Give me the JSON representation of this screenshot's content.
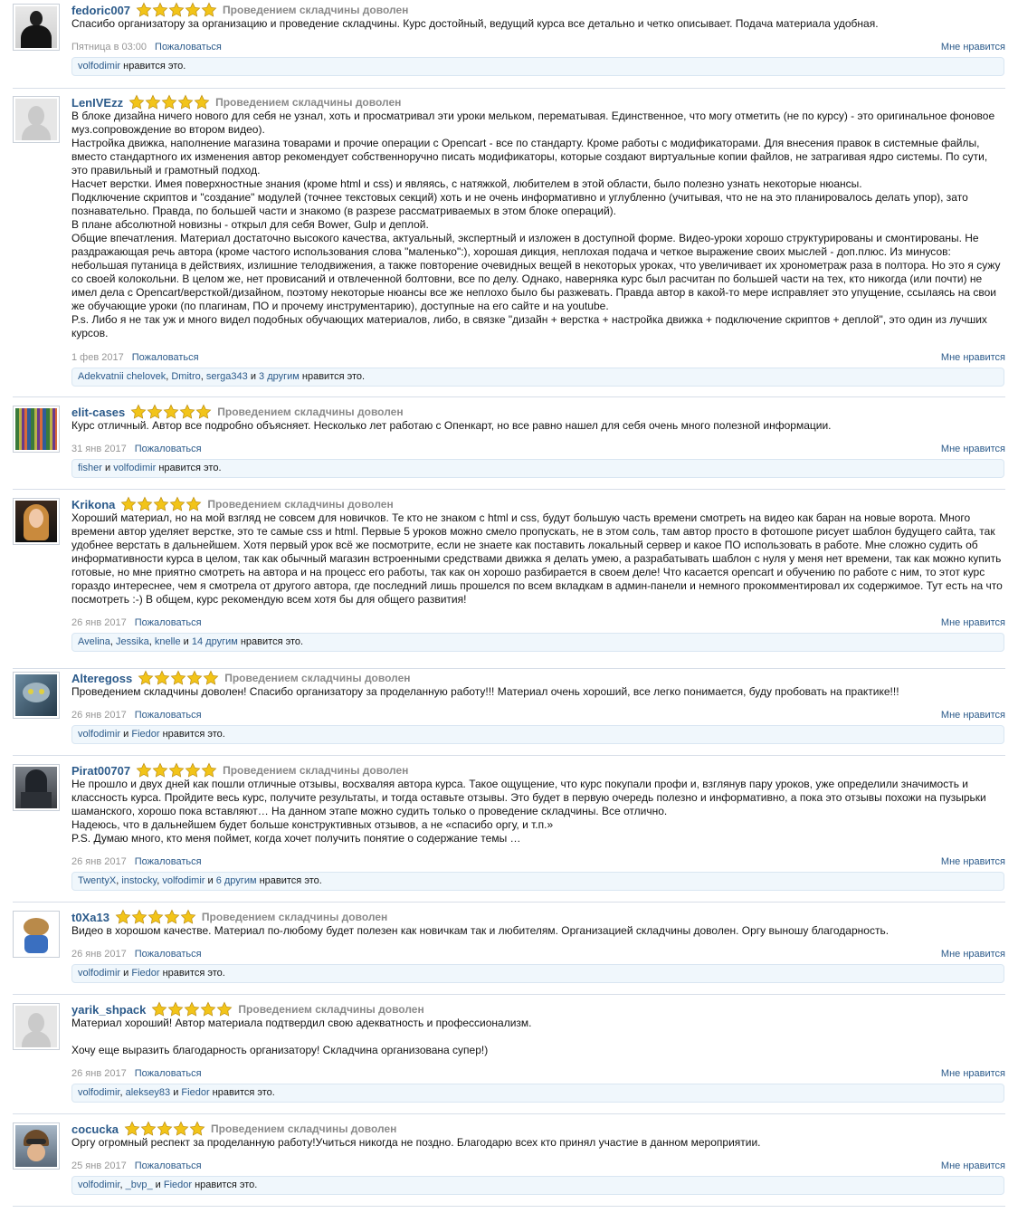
{
  "reviews": [
    {
      "author": "fedoric007",
      "avatar_icon": "user-avatar-suit",
      "rating": 5,
      "verdict": "Проведением складчины доволен",
      "text": "Спасибо организатору за организацию и проведение складчины. Курс достойный, ведущий курса все детально и четко описывает. Подача материала удобная.",
      "date": "Пятница в 03:00",
      "report_label": "Пожаловаться",
      "like_label": "Мне нравится",
      "likes": {
        "users": [
          "volfodimir"
        ],
        "others": "",
        "suffix": "нравится это."
      }
    },
    {
      "author": "LenIVEzz",
      "avatar_icon": "default-avatar-icon",
      "rating": 5,
      "verdict": "Проведением складчины доволен",
      "text": "В блоке дизайна ничего нового для себя не узнал, хоть и просматривал эти уроки мельком, перематывая. Единственное, что могу отметить (не по курсу) - это оригинальное фоновое муз.сопровождение во втором видео).\nНастройка движка, наполнение магазина товарами и прочие операции с Opencart - все по стандарту. Кроме работы с модификаторами. Для внесения правок в системные файлы, вместо стандартного их изменения автор рекомендует собственноручно писать модификаторы, которые создают виртуальные копии файлов, не затрагивая ядро системы. По сути, это правильный и грамотный подход.\nНасчет верстки. Имея поверхностные знания (кроме html и css) и являясь, с натяжкой, любителем в этой области, было полезно узнать некоторые нюансы.\nПодключение скриптов и \"создание\" модулей (точнее текстовых секций) хоть и не очень информативно и углубленно (учитывая, что не на это планировалось делать упор), зато познавательно. Правда, по большей части и знакомо (в разрезе рассматриваемых в этом блоке операций).\nВ плане абсолютной новизны - открыл для себя Bower, Gulp и деплой.\nОбщие впечатления. Материал достаточно высокого качества, актуальный, экспертный и изложен в доступной форме. Видео-уроки хорошо структурированы и смонтированы. Не раздражающая речь автора (кроме частого использования слова \"маленько\":), хорошая дикция, неплохая подача и четкое выражение своих мыслей - доп.плюс. Из минусов: небольшая путаница в действиях, излишние телодвижения, а также повторение очевидных вещей в некоторых уроках, что увеличивает их хронометраж раза в полтора. Но это я сужу со своей колокольни. В целом же, нет провисаний и отвлеченной болтовни, все по делу. Однако, наверняка курс был расчитан по большей части на тех, кто никогда (или почти) не имел дела с Opencart/версткой/дизайном, поэтому некоторые нюансы все же неплохо было бы разжевать. Правда автор в какой-то мере исправляет это упущение, ссылаясь на свои же обучающие уроки (по плагинам, ПО и прочему инструментарию), доступные на его сайте и на youtube.\nP.s. Либо я не так уж и много видел подобных обучающих материалов, либо, в связке \"дизайн + верстка + настройка движка + подключение скриптов + деплой\", это один из лучших курсов.",
      "date": "1 фев 2017",
      "report_label": "Пожаловаться",
      "like_label": "Мне нравится",
      "likes": {
        "users": [
          "Adekvatnii chelovek",
          "Dmitro",
          "serga343"
        ],
        "others": "3 другим",
        "suffix": "нравится это."
      }
    },
    {
      "author": "elit-cases",
      "avatar_icon": "books-avatar",
      "rating": 5,
      "verdict": "Проведением складчины доволен",
      "text": "Курс отличный. Автор все подробно объясняет. Несколько лет работаю с Опенкарт, но все равно нашел для себя очень много полезной информации.",
      "date": "31 янв 2017",
      "report_label": "Пожаловаться",
      "like_label": "Мне нравится",
      "likes": {
        "users": [
          "fisher",
          "volfodimir"
        ],
        "others": "",
        "suffix": "нравится это."
      }
    },
    {
      "author": "Krikona",
      "avatar_icon": "user-avatar-girl",
      "rating": 5,
      "verdict": "Проведением складчины доволен",
      "text": "Хороший материал, но на мой взгляд не совсем для новичков. Те кто не знаком с html и css, будут большую часть времени смотреть на видео как баран на новые ворота. Много времени автор уделяет верстке, это те самые css и html. Первые 5 уроков можно смело пропускать, не в этом соль, там автор просто в фотошопе рисует шаблон будущего сайта, так удобнее верстать в дальнейшем. Хотя первый урок всё же посмотрите, если не знаете как поставить локальный сервер и какое ПО использовать в работе. Мне сложно судить об информативности курса в целом, так как обычный магазин встроенными средствами движка я делать умею, а разрабатывать шаблон с нуля у меня нет времени, так как можно купить готовые, но мне приятно смотреть на автора и на процесс его работы, так как он хорошо разбирается в своем деле! Что касается opencart и обучению по работе с ним, то этот курс гораздо интереснее, чем я смотрела от другого автора, где последний лишь прошелся по всем вкладкам в админ-панели и немного прокомментировал их содержимое. Тут есть на что посмотреть :-) В общем, курс рекомендую всем хотя бы для общего развития!",
      "date": "26 янв 2017",
      "report_label": "Пожаловаться",
      "like_label": "Мне нравится",
      "likes": {
        "users": [
          "Avelina",
          "Jessika",
          "knelle"
        ],
        "others": "14 другим",
        "suffix": "нравится это."
      }
    },
    {
      "author": "Alteregoss",
      "avatar_icon": "cat-avatar",
      "rating": 5,
      "verdict": "Проведением складчины доволен",
      "text": "Проведением складчины доволен! Спасибо организатору за проделанную работу!!! Материал очень хороший, все легко понимается, буду пробовать на практике!!!",
      "date": "26 янв 2017",
      "report_label": "Пожаловаться",
      "like_label": "Мне нравится",
      "likes": {
        "users": [
          "volfodimir",
          "Fiedor"
        ],
        "others": "",
        "suffix": "нравится это."
      }
    },
    {
      "author": "Pirat00707",
      "avatar_icon": "assassin-avatar",
      "rating": 5,
      "verdict": "Проведением складчины доволен",
      "text": "Не прошло и двух дней как пошли отличные отзывы, восхваляя автора курса. Такое ощущение, что курс покупали профи и, взглянув пару уроков, уже определили значимость и классность курса. Пройдите весь курс, получите результаты, и тогда оставьте отзывы. Это будет в первую очередь полезно и информативно, а пока это отзывы похожи на пузырьки шаманского, хорошо пока вставляют… На данном этапе можно судить только о проведение складчины. Все отлично.\nНадеюсь, что в дальнейшем будет больше конструктивных отзывов, а не «спасибо оргу, и т.п.»\nP.S. Думаю много, кто меня поймет, когда хочет получить понятие о содержание темы …",
      "date": "26 янв 2017",
      "report_label": "Пожаловаться",
      "like_label": "Мне нравится",
      "likes": {
        "users": [
          "TwentyX",
          "instocky",
          "volfodimir"
        ],
        "others": "6 другим",
        "suffix": "нравится это."
      }
    },
    {
      "author": "t0Xa13",
      "avatar_icon": "mascot-avatar",
      "rating": 5,
      "verdict": "Проведением складчины доволен",
      "text": "Видео в хорошом качестве. Материал по-любому будет полезен как новичкам так и любителям. Организацией складчины доволен. Оргу выношу благодарность.",
      "date": "26 янв 2017",
      "report_label": "Пожаловаться",
      "like_label": "Мне нравится",
      "likes": {
        "users": [
          "volfodimir",
          "Fiedor"
        ],
        "others": "",
        "suffix": "нравится это."
      }
    },
    {
      "author": "yarik_shpack",
      "avatar_icon": "default-avatar-icon",
      "rating": 5,
      "verdict": "Проведением складчины доволен",
      "text": "Материал хороший! Автор материала подтвердил свою адекватность и профессионализм.\n\nХочу еще выразить благодарность организатору! Складчина организована супер!)",
      "date": "26 янв 2017",
      "report_label": "Пожаловаться",
      "like_label": "Мне нравится",
      "likes": {
        "users": [
          "volfodimir",
          "aleksey83",
          "Fiedor"
        ],
        "others": "",
        "suffix": "нравится это."
      }
    },
    {
      "author": "cocucka",
      "avatar_icon": "rider-avatar",
      "rating": 5,
      "verdict": "Проведением складчины доволен",
      "text": "Оргу огромный респект за проделанную работу!Учиться никогда не поздно. Благодарю всех кто принял участие в данном мероприятии.",
      "date": "25 янв 2017",
      "report_label": "Пожаловаться",
      "like_label": "Мне нравится",
      "likes": {
        "users": [
          "volfodimir",
          "_bvp_",
          "Fiedor"
        ],
        "others": "",
        "suffix": "нравится это."
      }
    }
  ],
  "connectors": {
    "and": "и"
  },
  "colors": {
    "link": "#2b5a8a",
    "star": "#f2c419",
    "likes_bg": "#f0f7fc",
    "separator": "#d7dee8"
  }
}
